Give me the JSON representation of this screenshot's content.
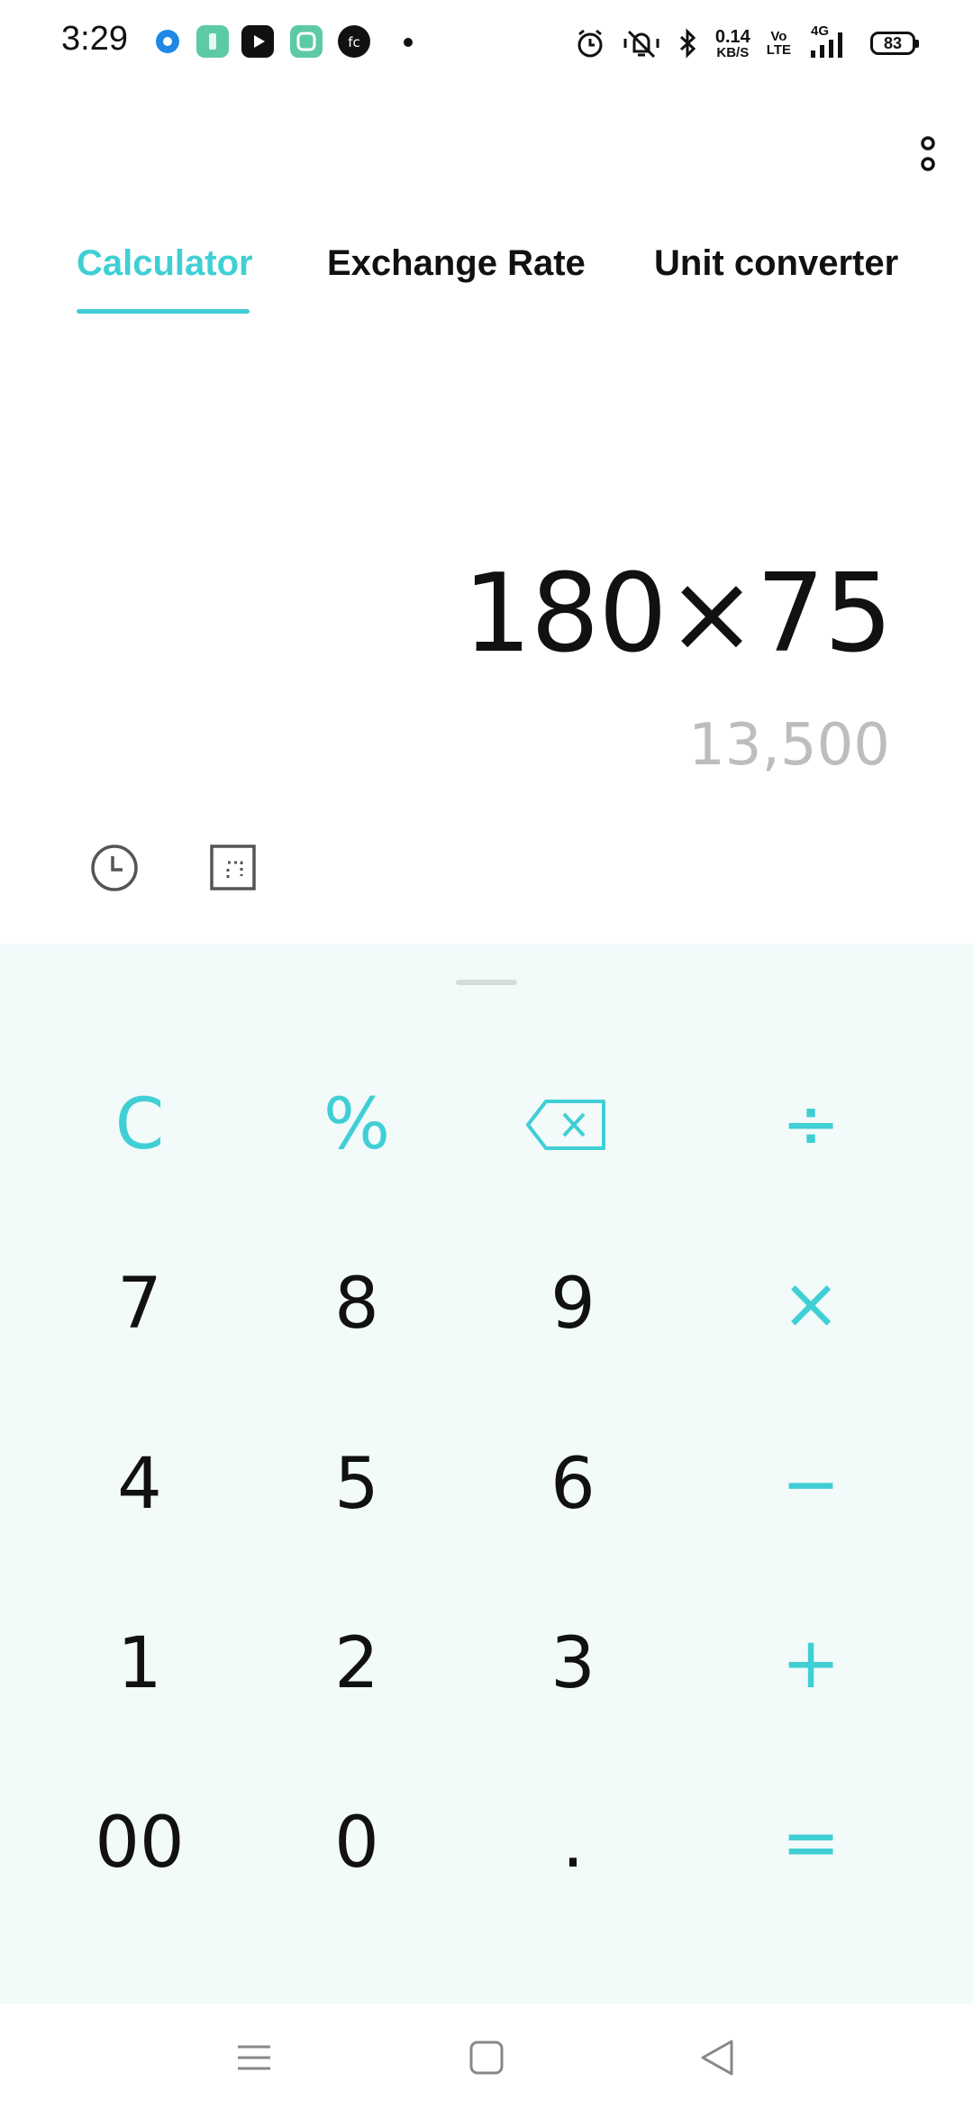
{
  "status_bar": {
    "time": "3:29",
    "net_speed_value": "0.14",
    "net_speed_unit": "KB/S",
    "volte_top": "Vo",
    "volte_bottom": "LTE",
    "network_type": "4G",
    "battery_level": "83",
    "notification_icons": [
      "blue-circle-app-icon",
      "green-app-icon",
      "youtube-icon",
      "teal-square-app-icon",
      "fc-app-icon",
      "more-dot-icon"
    ],
    "system_icons": [
      "alarm-icon",
      "vibrate-silent-icon",
      "bluetooth-icon",
      "signal-icon",
      "battery-icon"
    ]
  },
  "tabs": [
    {
      "label": "Calculator",
      "active": true
    },
    {
      "label": "Exchange Rate",
      "active": false
    },
    {
      "label": "Unit converter",
      "active": false
    }
  ],
  "display": {
    "expression": "180×75",
    "result": "13,500"
  },
  "tools": [
    "history-icon",
    "scientific-mode-icon"
  ],
  "keys": {
    "clear": "C",
    "percent": "%",
    "backspace_icon": "backspace-icon",
    "divide": "÷",
    "seven": "7",
    "eight": "8",
    "nine": "9",
    "multiply": "×",
    "four": "4",
    "five": "5",
    "six": "6",
    "minus": "−",
    "one": "1",
    "two": "2",
    "three": "3",
    "plus": "+",
    "double_zero": "00",
    "zero": "0",
    "decimal": ".",
    "equals": "="
  },
  "colors": {
    "accent": "#3fcfd4",
    "keypad_bg": "#f2fafa",
    "result_text": "#bdbdbd"
  }
}
